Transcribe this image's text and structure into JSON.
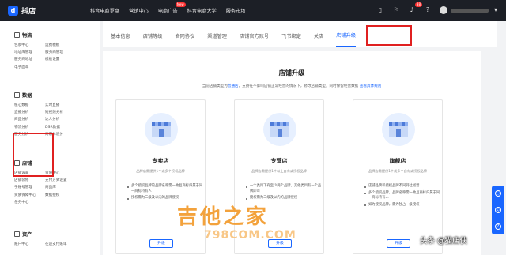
{
  "topbar": {
    "logo": "抖店",
    "logo_mark": "d",
    "nav": [
      {
        "label": "抖音电商罗盘"
      },
      {
        "label": "营销中心"
      },
      {
        "label": "电商广告",
        "badge": "New"
      },
      {
        "label": "抖音电商大学"
      },
      {
        "label": "服务市场"
      }
    ],
    "message_count": "38"
  },
  "sidebar": {
    "sections": [
      {
        "title": "物流",
        "items": [
          "包裹中心",
          "运费模板",
          "地址库管理",
          "服务商管理",
          "服务商地址",
          "模板设置",
          "电子面单",
          ""
        ]
      },
      {
        "title": "数据",
        "items": [
          "核心数据",
          "实时直播",
          "直播分析",
          "短视频分析",
          "商品分析",
          "达人分析",
          "物流分析",
          "DSR数据",
          "服务分析",
          "商家体验分"
        ]
      },
      {
        "title": "店铺",
        "items": [
          "店铺设置",
          "资质中心",
          "店铺装修",
          "支付方式设置",
          "子账号管理",
          "商品库",
          "资质保障中心",
          "数据授权",
          "任务中心",
          ""
        ]
      },
      {
        "title": "资产",
        "items": [
          "账户中心",
          "在途支付账单"
        ]
      }
    ]
  },
  "tabs": [
    {
      "label": "基本信息"
    },
    {
      "label": "店铺等级"
    },
    {
      "label": "合同协议"
    },
    {
      "label": "渠道管理"
    },
    {
      "label": "店铺官方账号"
    },
    {
      "label": "飞书绑定"
    },
    {
      "label": "关店"
    },
    {
      "label": "店铺升级",
      "active": true
    }
  ],
  "panel": {
    "title": "店铺升级",
    "desc_before": "当前店铺类型为",
    "desc_type": "普通店",
    "desc_after": "，支持在不影响店铺正常经营的情况下，修改店铺类型，同时保留经营数据",
    "desc_link": "查看具体规则"
  },
  "cards": [
    {
      "name": "专卖店",
      "sub": "品牌店需提供1个或多个授权品牌",
      "points": [
        "多个授权品牌的品牌名称需一致且商标归属于同一商标持有人",
        "授权需为二级及以内的品牌授权"
      ],
      "button": "升级"
    },
    {
      "name": "专营店",
      "sub": "品牌店需提供1个以上自有或授权品牌",
      "points": [
        "一个类目下有至少两个品牌，其他类目有一个品牌即可",
        "授权需为二级及以内的品牌授权"
      ],
      "button": "升级"
    },
    {
      "name": "旗舰店",
      "sub": "品牌店需提供1个或多个自有或授权品牌",
      "points": [
        "店铺品牌和授权品牌不同持社经营",
        "多个授权品牌，品牌名称需一致且商标归属于同一商标持有人",
        "如为授权品牌，需为独占一级授权"
      ],
      "button": "升级"
    }
  ],
  "floatbar": {
    "icons": [
      "chat-icon",
      "headset-icon",
      "question-icon"
    ]
  },
  "watermarks": {
    "main": "吉他之家",
    "sub": "798COM.COM",
    "corner": "头条 @猫店侠"
  },
  "colors": {
    "accent": "#1966ff",
    "highlight": "#e02020",
    "topbar": "#1c1f26"
  }
}
